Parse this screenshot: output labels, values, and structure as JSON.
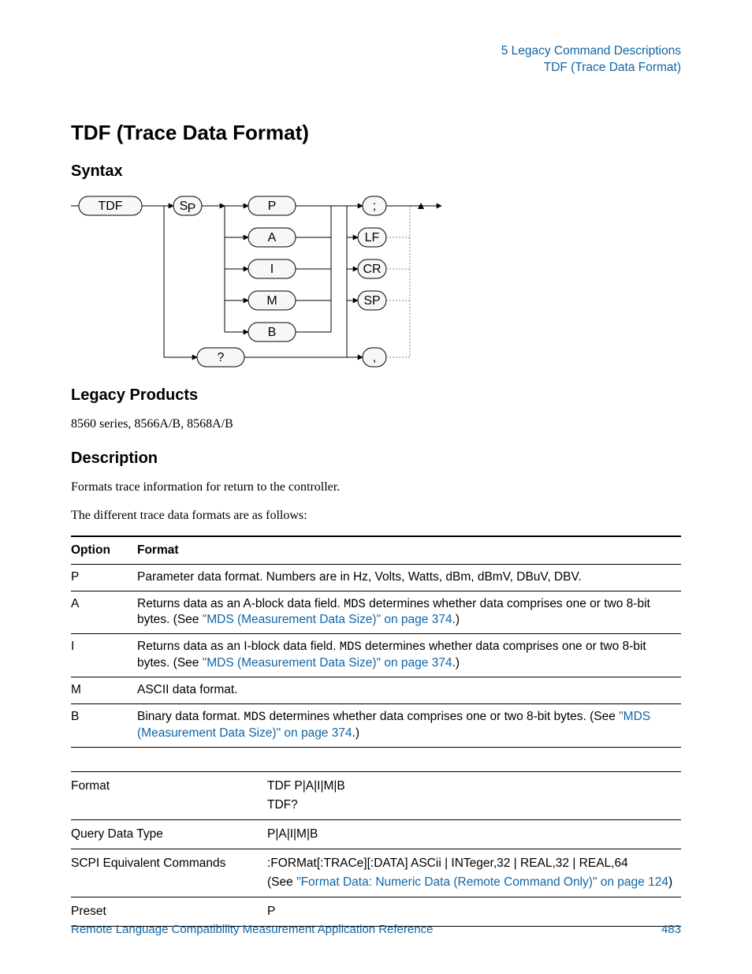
{
  "running_header": {
    "line1": "5  Legacy Command Descriptions",
    "line2": "TDF (Trace Data Format)"
  },
  "title": "TDF (Trace Data Format)",
  "syntax": {
    "heading": "Syntax",
    "start_box": "TDF",
    "sp_box": "S",
    "sp_sub": "P",
    "options": [
      "P",
      "A",
      "I",
      "M",
      "B"
    ],
    "question": "?",
    "terminators": [
      ";",
      "LF",
      "CR",
      "SP",
      ","
    ]
  },
  "legacy": {
    "heading": "Legacy Products",
    "body": "8560 series, 8566A/B, 8568A/B"
  },
  "description": {
    "heading": "Description",
    "p1": "Formats trace information for return to the controller.",
    "p2": "The different trace data formats are as follows:"
  },
  "options_table": {
    "headers": {
      "option": "Option",
      "format": "Format"
    },
    "rows": [
      {
        "option": "P",
        "format_parts": [
          {
            "t": "text",
            "v": "Parameter data format. Numbers are in Hz, Volts, Watts, dBm, dBmV, DBuV, DBV."
          }
        ]
      },
      {
        "option": "A",
        "format_parts": [
          {
            "t": "text",
            "v": "Returns data as an A-block data field. "
          },
          {
            "t": "mono",
            "v": "MDS"
          },
          {
            "t": "text",
            "v": "  determines whether data comprises one or two 8-bit bytes. (See "
          },
          {
            "t": "link",
            "v": "\"MDS (Measurement Data Size)\" on page 374"
          },
          {
            "t": "text",
            "v": ".)"
          }
        ]
      },
      {
        "option": "I",
        "format_parts": [
          {
            "t": "text",
            "v": "Returns data as an I-block data field. "
          },
          {
            "t": "mono",
            "v": "MDS"
          },
          {
            "t": "text",
            "v": "  determines whether data comprises one or two 8-bit bytes. (See "
          },
          {
            "t": "link",
            "v": "\"MDS (Measurement Data Size)\" on page 374"
          },
          {
            "t": "text",
            "v": ".)"
          }
        ]
      },
      {
        "option": "M",
        "format_parts": [
          {
            "t": "text",
            "v": "ASCII data format."
          }
        ]
      },
      {
        "option": "B",
        "format_parts": [
          {
            "t": "text",
            "v": "Binary data format. "
          },
          {
            "t": "mono",
            "v": "MDS"
          },
          {
            "t": "text",
            "v": "  determines whether data comprises one or two 8-bit bytes. (See "
          },
          {
            "t": "link",
            "v": "\"MDS (Measurement Data Size)\" on page 374"
          },
          {
            "t": "text",
            "v": ".)"
          }
        ]
      }
    ]
  },
  "details_table": {
    "rows": [
      {
        "label": "Format",
        "value_parts": [
          {
            "t": "text",
            "v": "TDF P|A|I|M|B\nTDF?"
          }
        ]
      },
      {
        "label": "Query Data Type",
        "value_parts": [
          {
            "t": "text",
            "v": "P|A|I|M|B"
          }
        ]
      },
      {
        "label": "SCPI Equivalent Commands",
        "value_parts": [
          {
            "t": "text",
            "v": ":FORMat[:TRACe][:DATA] ASCii | INTeger,32 | REAL,32 | REAL,64\n(See "
          },
          {
            "t": "link",
            "v": "\"Format Data: Numeric Data (Remote Command Only)\" on page 124"
          },
          {
            "t": "text",
            "v": ")"
          }
        ]
      },
      {
        "label": "Preset",
        "value_parts": [
          {
            "t": "text",
            "v": "P"
          }
        ]
      }
    ]
  },
  "footer": {
    "left": "Remote Language Compatibility Measurement Application Reference",
    "right": "483"
  }
}
